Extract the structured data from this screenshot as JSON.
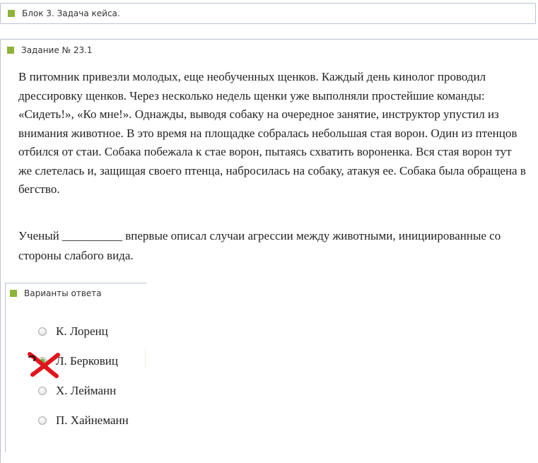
{
  "block": {
    "title": "Блок 3. Задача кейса."
  },
  "task": {
    "title": "Задание № 23.1",
    "text": "В питомник привезли молодых, еще необученных щенков. Каждый день кинолог проводил дрессировку щенков. Через несколько недель щенки уже выполняли простейшие команды: «Сидеть!», «Ко мне!». Однажды, выводя собаку на очередное занятие, инструктор упустил из внимания животное. В это время на площадке собралась небольшая стая ворон. Один из птенцов отбился от стаи. Собака побежала к стае ворон, пытаясь схватить вороненка. Вся стая ворон тут же слетелась и, защищая своего птенца, набросилась на собаку, атакуя ее. Собака была обращена в бегство.",
    "question": "Ученый __________ впервые описал случаи агрессии между животными, инициированные со стороны слабого вида."
  },
  "answers": {
    "title": "Варианты ответа",
    "options": [
      {
        "label": "К. Лоренц",
        "selected": false
      },
      {
        "label": "Л. Берковиц",
        "selected": true
      },
      {
        "label": "Х. Лейманн",
        "selected": false
      },
      {
        "label": "П. Хайнеманн",
        "selected": false
      }
    ]
  },
  "colors": {
    "accent": "#8db33a",
    "border": "#b9c3d1",
    "selected_radio": "#6fb43f",
    "cross_mark": "#e0141c"
  },
  "icons": {
    "section_marker": "green-square-icon",
    "wrong_mark": "red-cross-icon"
  }
}
